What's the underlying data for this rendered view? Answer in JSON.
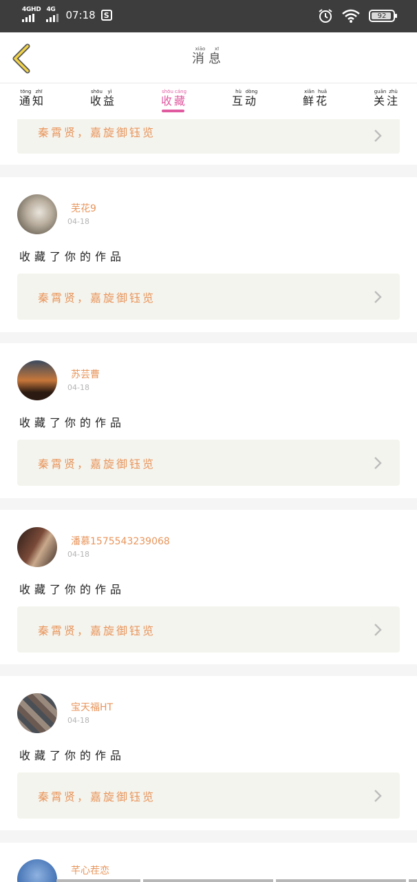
{
  "status_bar": {
    "signal1_label": "4GHD",
    "signal2_label": "4G",
    "time": "07:18",
    "s_icon": "S",
    "battery_level": "92"
  },
  "header": {
    "title": "消息",
    "title_pinyin": [
      "xiāo",
      "xī"
    ]
  },
  "tabs": [
    {
      "label": "通知",
      "pinyin": [
        "tōng",
        "zhī"
      ],
      "active": false
    },
    {
      "label": "收益",
      "pinyin": [
        "shōu",
        "yì"
      ],
      "active": false
    },
    {
      "label": "收藏",
      "pinyin": [
        "shōu",
        "cáng"
      ],
      "active": true
    },
    {
      "label": "互动",
      "pinyin": [
        "hù",
        "dòng"
      ],
      "active": false
    },
    {
      "label": "鲜花",
      "pinyin": [
        "xiān",
        "huā"
      ],
      "active": false
    },
    {
      "label": "关注",
      "pinyin": [
        "guān",
        "zhù"
      ],
      "active": false
    }
  ],
  "colors": {
    "accent": "#e05aa0",
    "name": "#e8955b",
    "work_bg": "#f4f4ee"
  },
  "feed": {
    "partial_top_work_title": "秦霄贤，嘉旋御钰览",
    "items": [
      {
        "username": "芜花9",
        "date": "04-18",
        "action": "收藏了你的作品",
        "work_title": "秦霄贤，嘉旋御钰览"
      },
      {
        "username": "苏芸曹",
        "date": "04-18",
        "action": "收藏了你的作品",
        "work_title": "秦霄贤，嘉旋御钰览"
      },
      {
        "username": "潘慕15755432390​68",
        "date": "04-18",
        "action": "收藏了你的作品",
        "work_title": "秦霄贤，嘉旋御钰览"
      },
      {
        "username": "宝天福HT",
        "date": "04-18",
        "action": "收藏了你的作品",
        "work_title": "秦霄贤，嘉旋御钰览"
      },
      {
        "username": "芊心茬恋",
        "date": "",
        "action": "",
        "work_title": ""
      }
    ]
  }
}
